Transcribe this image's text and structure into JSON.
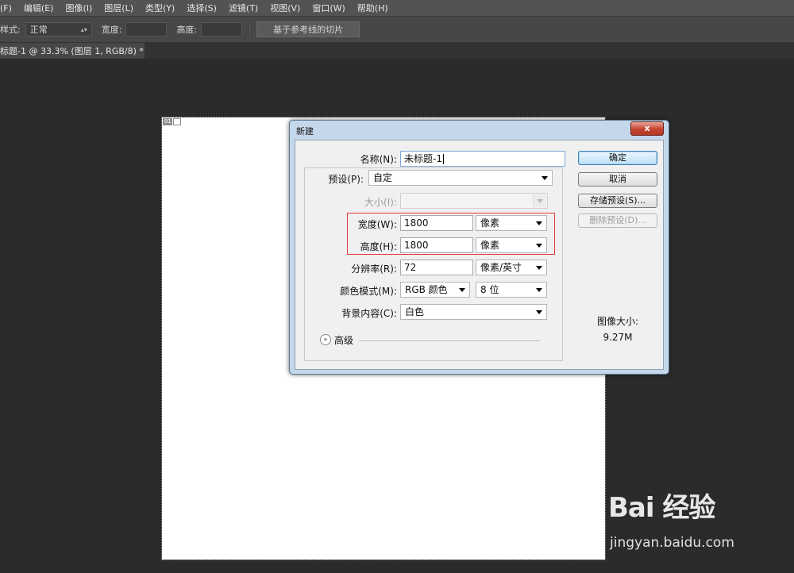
{
  "menubar": {
    "items": [
      "(F)",
      "编辑(E)",
      "图像(I)",
      "图层(L)",
      "类型(Y)",
      "选择(S)",
      "滤镜(T)",
      "视图(V)",
      "窗口(W)",
      "帮助(H)"
    ]
  },
  "options": {
    "style_label": "样式:",
    "style_value": "正常",
    "width_label": "宽度:",
    "height_label": "高度:",
    "slice_button": "基于参考线的切片"
  },
  "document_tab": {
    "title": "标题-1 @ 33.3% (图层 1, RGB/8) *",
    "close": "×"
  },
  "canvas": {
    "slice_number": "01"
  },
  "dialog": {
    "title": "新建",
    "close": "x",
    "name_label": "名称(N):",
    "name_value": "未标题-1",
    "preset_label": "预设(P):",
    "preset_value": "自定",
    "size_label": "大小(I):",
    "width_label": "宽度(W):",
    "width_value": "1800",
    "width_unit": "像素",
    "height_label": "高度(H):",
    "height_value": "1800",
    "height_unit": "像素",
    "resolution_label": "分辨率(R):",
    "resolution_value": "72",
    "resolution_unit": "像素/英寸",
    "color_mode_label": "颜色模式(M):",
    "color_mode_value": "RGB 颜色",
    "bit_depth_value": "8 位",
    "background_label": "背景内容(C):",
    "background_value": "白色",
    "advanced_label": "高级",
    "ok_button": "确定",
    "cancel_button": "取消",
    "save_preset_button": "存储预设(S)...",
    "delete_preset_button": "删除预设(D)...",
    "image_size_label": "图像大小:",
    "image_size_value": "9.27M"
  },
  "watermark": {
    "logo": "Bai 经验",
    "url": "jingyan.baidu.com"
  }
}
